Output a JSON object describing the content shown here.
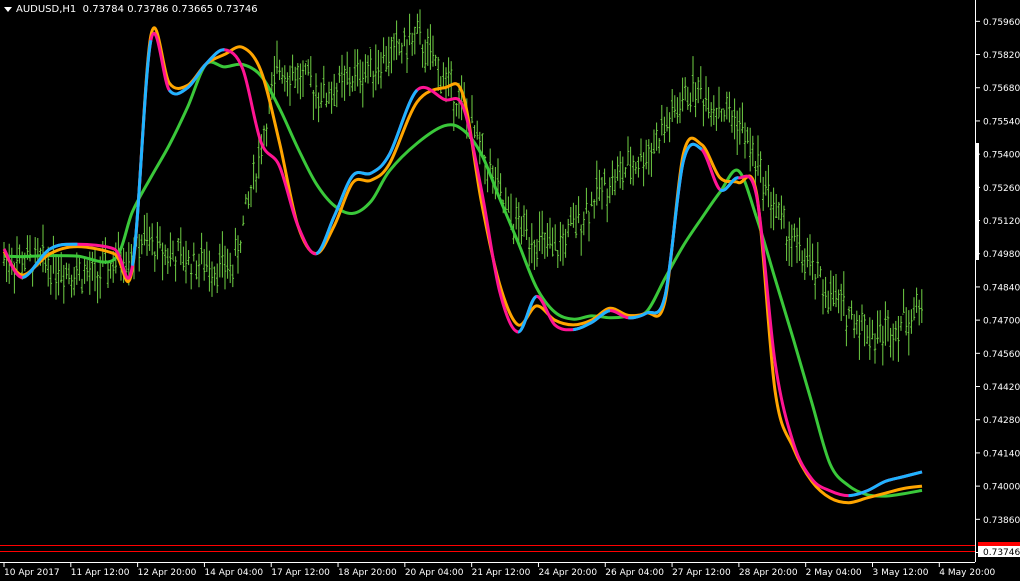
{
  "header": {
    "symbol": "AUDUSD,H1",
    "open": "0.73784",
    "high": "0.73786",
    "low": "0.73665",
    "close": "0.73746"
  },
  "colors": {
    "background": "#000000",
    "candles": "#6fcf45",
    "grid_axis": "#ffffff",
    "price_line": "#ff0000",
    "current_price_box": "#ffffff",
    "ma_orange": "#ffa500",
    "ma_magenta": "#ff1493",
    "ma_blue": "#1eb4ff",
    "ma_green": "#3ac83a"
  },
  "chart_data": {
    "type": "line",
    "title": "AUDUSD,H1",
    "y_ticks": [
      "0.75960",
      "0.75820",
      "0.75680",
      "0.75540",
      "0.75400",
      "0.75260",
      "0.75120",
      "0.74980",
      "0.74840",
      "0.74700",
      "0.74560",
      "0.74420",
      "0.74280",
      "0.74140",
      "0.74000",
      "0.73860",
      "0.73720"
    ],
    "ylim": [
      0.7368,
      0.7605
    ],
    "current_price": "0.73746",
    "x_ticks": [
      "10 Apr 2017",
      "11 Apr 12:00",
      "12 Apr 20:00",
      "14 Apr 04:00",
      "17 Apr 12:00",
      "18 Apr 20:00",
      "20 Apr 04:00",
      "21 Apr 12:00",
      "24 Apr 20:00",
      "26 Apr 04:00",
      "27 Apr 12:00",
      "28 Apr 20:00",
      "2 May 04:00",
      "3 May 12:00",
      "4 May 20:00"
    ],
    "price_series_x": [
      0,
      5,
      10,
      15,
      20,
      25,
      30,
      35,
      40,
      45,
      50,
      55,
      60,
      65,
      70,
      75,
      80,
      85,
      90,
      95,
      100
    ],
    "price_series_y": [
      0.7496,
      0.7494,
      0.7488,
      0.7503,
      0.7495,
      0.7492,
      0.7578,
      0.7565,
      0.7577,
      0.7589,
      0.756,
      0.7513,
      0.7498,
      0.7525,
      0.754,
      0.7568,
      0.7554,
      0.7508,
      0.748,
      0.7463,
      0.7475
    ],
    "series": [
      {
        "name": "",
        "color": "ma_orange",
        "x": [
          0,
          2,
          5,
          8,
          12,
          14,
          16,
          18,
          20,
          22,
          24,
          26,
          28,
          30,
          32,
          34,
          36,
          38,
          40,
          42,
          45,
          48,
          50,
          52,
          54,
          56,
          58,
          60,
          62,
          64,
          66,
          68,
          70,
          72,
          74,
          76,
          78,
          80,
          82,
          84,
          86,
          88,
          90,
          92,
          94,
          96,
          98,
          100
        ],
        "y": [
          0.7499,
          0.7489,
          0.7498,
          0.7501,
          0.7498,
          0.7492,
          0.759,
          0.757,
          0.7569,
          0.7578,
          0.7582,
          0.7585,
          0.7575,
          0.7545,
          0.751,
          0.7498,
          0.751,
          0.7528,
          0.7529,
          0.7536,
          0.7562,
          0.7568,
          0.7565,
          0.752,
          0.7485,
          0.7468,
          0.7476,
          0.747,
          0.7468,
          0.747,
          0.7475,
          0.7472,
          0.7473,
          0.7478,
          0.754,
          0.7544,
          0.753,
          0.7528,
          0.7523,
          0.744,
          0.7416,
          0.7402,
          0.7395,
          0.7393,
          0.7395,
          0.7397,
          0.7399,
          0.74
        ]
      },
      {
        "name": "",
        "color": "ma_magenta",
        "x": [
          0,
          2,
          5,
          8,
          12,
          14,
          16,
          18,
          20,
          22,
          24,
          26,
          28,
          30,
          32,
          34,
          36,
          38,
          40,
          42,
          45,
          48,
          50,
          52,
          54,
          56,
          58,
          60,
          62,
          64,
          66,
          68,
          70,
          72,
          74,
          76,
          78,
          80,
          82,
          84,
          86,
          88,
          90,
          92,
          94,
          96,
          98,
          100
        ],
        "y": [
          0.75,
          0.7488,
          0.75,
          0.7502,
          0.75,
          0.7493,
          0.7588,
          0.7567,
          0.7568,
          0.7578,
          0.7584,
          0.7576,
          0.7545,
          0.7535,
          0.751,
          0.7498,
          0.7514,
          0.7531,
          0.7532,
          0.754,
          0.7567,
          0.7563,
          0.756,
          0.7525,
          0.7482,
          0.7465,
          0.748,
          0.7468,
          0.7466,
          0.7469,
          0.7474,
          0.7471,
          0.7473,
          0.748,
          0.7537,
          0.7542,
          0.7525,
          0.753,
          0.7522,
          0.7452,
          0.7418,
          0.7403,
          0.7398,
          0.7396,
          0.7398,
          0.7402,
          0.7404,
          0.7406
        ]
      }
    ]
  }
}
